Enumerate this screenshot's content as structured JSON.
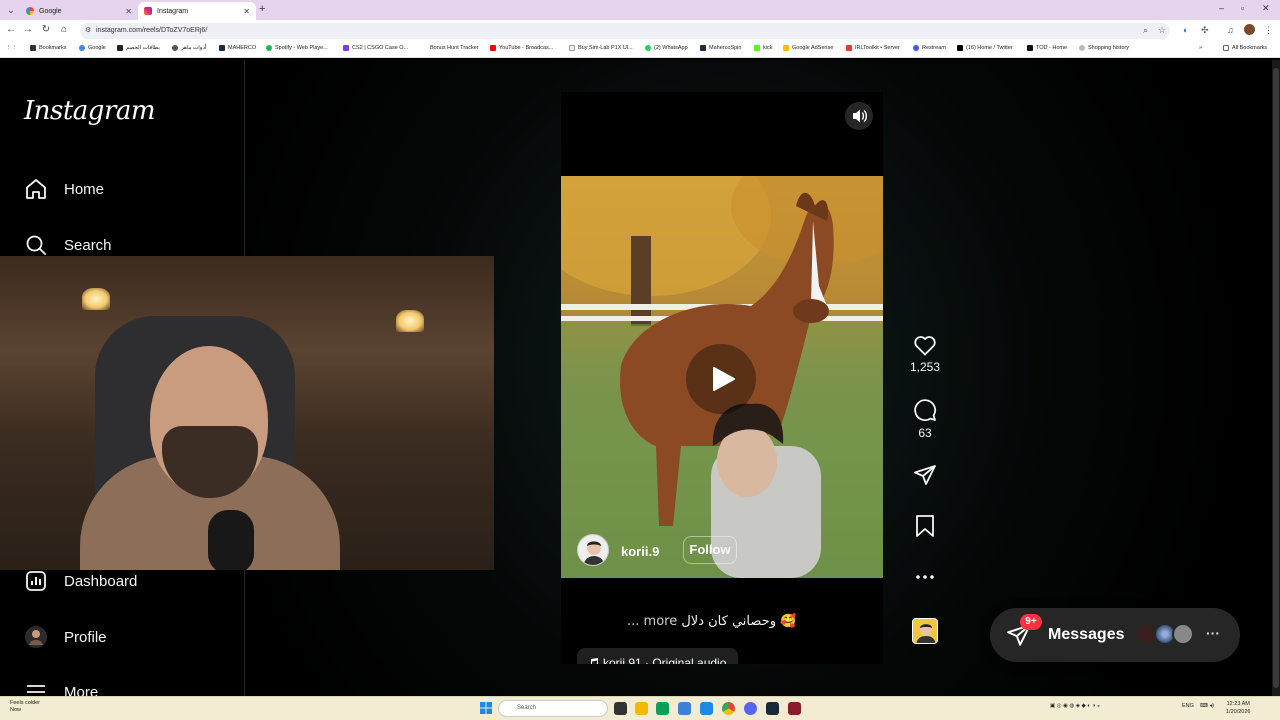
{
  "browser": {
    "tabs": [
      {
        "title": "Google",
        "active": false
      },
      {
        "title": "Instagram",
        "active": true
      }
    ],
    "url": "instagram.com/reels/DToZV7oERj6/",
    "bookmarks": [
      "Bookmarks",
      "Google",
      "بطاقات الخصم",
      "أدوات ماهر",
      "MAHERCO",
      "Spotify - Web Playe...",
      "CS2 | CSGO Case O...",
      "Bonus Hunt Tracker",
      "YouTube - Broadcas...",
      "Buy Sim-Lab P1X Ul...",
      "(2) WhatsApp",
      "MahercoSpin",
      "kick",
      "Google AdSense",
      "IRLToolkit • Server",
      "Restream",
      "(16) Home / Twitter",
      "TOD - Home",
      "Shopping history"
    ],
    "all_bookmarks": "All Bookmarks"
  },
  "sidebar": {
    "logo": "Instagram",
    "items": [
      {
        "label": "Home",
        "icon": "home-icon"
      },
      {
        "label": "Search",
        "icon": "search-icon"
      },
      {
        "label": "Dashboard",
        "icon": "dashboard-icon"
      },
      {
        "label": "Profile",
        "icon": "profile-avatar"
      },
      {
        "label": "More",
        "icon": "menu-icon"
      }
    ]
  },
  "reel": {
    "username": "korii.9",
    "follow_label": "Follow",
    "caption": "وحصاني كان دلال 🥰",
    "caption_more": "... more",
    "audio": "korii.91 · Original audio"
  },
  "actions": {
    "likes": "1,253",
    "comments": "63"
  },
  "messages": {
    "label": "Messages",
    "badge": "9+"
  },
  "taskbar": {
    "weather_line1": "Feels colder",
    "weather_line2": "Now",
    "search_placeholder": "Search",
    "lang": "ENG",
    "time": "12:23 AM",
    "date": "1/20/2026"
  },
  "colors": {
    "tabbar": "#e6d3ee",
    "page_bg": "#000000",
    "messages_bg": "#262626",
    "badge": "#ff3040",
    "taskbar": "#f1ecd2"
  }
}
